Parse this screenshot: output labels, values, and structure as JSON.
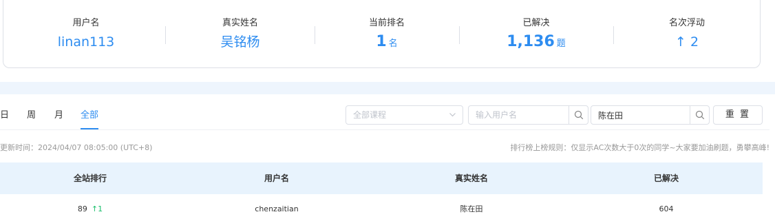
{
  "stats": {
    "username": {
      "label": "用户名",
      "value": "linan113"
    },
    "realname": {
      "label": "真实姓名",
      "value": "吴铭杨"
    },
    "rank": {
      "label": "当前排名",
      "value": "1",
      "unit": "名"
    },
    "solved": {
      "label": "已解决",
      "value": "1,136",
      "unit": "题"
    },
    "change": {
      "label": "名次浮动",
      "arrow": "↑",
      "value": "2"
    }
  },
  "tabs": [
    "日",
    "周",
    "月",
    "全部"
  ],
  "active_tab": "全部",
  "filters": {
    "course_placeholder": "全部课程",
    "username_placeholder": "输入用户名",
    "realname_value": "陈在田",
    "reset_label": "重 置"
  },
  "updated_text": "更新时间：2024/04/07 08:05:00 (UTC+8)",
  "rule_text": "排行榜上榜规则：仅显示AC次数大于0次的同学~大家要加油刷题，勇攀高峰!",
  "table": {
    "headers": [
      "全站排行",
      "用户名",
      "真实姓名",
      "已解决"
    ],
    "rows": [
      {
        "rank": "89",
        "trend": "↑1",
        "username": "chenzaitian",
        "realname": "陈在田",
        "solved": "604"
      }
    ]
  },
  "colors": {
    "accent": "#2d8cf0",
    "up": "#19be6b",
    "header_bg": "#e8f3fd",
    "band_bg": "#eef5fd"
  }
}
